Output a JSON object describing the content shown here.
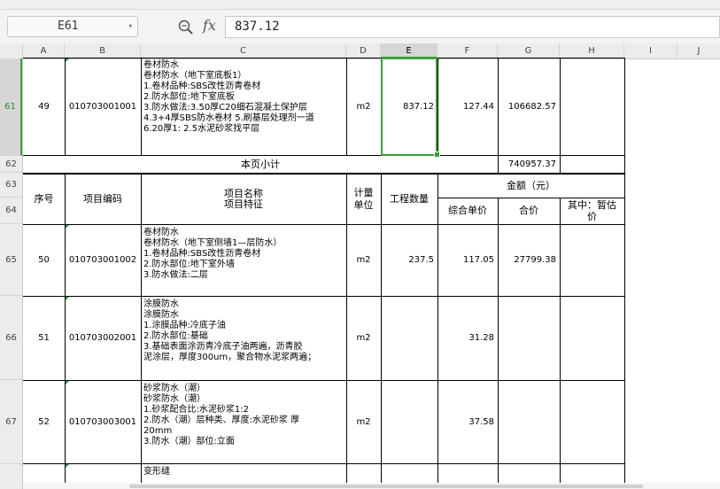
{
  "name_box": "E61",
  "formula_value": "837.12",
  "column_headers": [
    "A",
    "B",
    "C",
    "D",
    "E",
    "F",
    "G",
    "H",
    "I",
    "J"
  ],
  "row_headers": [
    "61",
    "62",
    "63",
    "64",
    "65",
    "66",
    "67"
  ],
  "rows": {
    "r61": {
      "seq": "49",
      "code": "010703001001",
      "desc": "卷材防水\n卷材防水（地下室底板1）\n1.卷材品种:SBS改性沥青卷材\n2.防水部位:地下室底板\n3.防水做法:3.50厚C20细石混凝土保护层\n4.3+4厚SBS防水卷材 5.刷基层处理剂一道\n6.20厚1: 2.5水泥砂浆找平层",
      "unit": "m2",
      "qty": "837.12",
      "price": "127.44",
      "total": "106682.57"
    },
    "r62": {
      "label": "本页小计",
      "total": "740957.37"
    },
    "header": {
      "seq": "序号",
      "code": "项目编码",
      "name": "项目名称\n项目特征",
      "unit": "计量\n单位",
      "qty": "工程数量",
      "amount": "金额（元）",
      "price": "综合单价",
      "total": "合价",
      "temp": "其中：暂估\n价"
    },
    "r65": {
      "seq": "50",
      "code": "010703001002",
      "desc": "卷材防水\n卷材防水（地下室侧墙1—层防水）\n1.卷材品种:SBS改性沥青卷材\n2.防水部位:地下室外墙\n3.防水做法:二层",
      "unit": "m2",
      "qty": "237.5",
      "price": "117.05",
      "total": "27799.38"
    },
    "r66": {
      "seq": "51",
      "code": "010703002001",
      "desc": "涂膜防水\n涂膜防水\n1.涂膜品种:冷底子油\n2.防水部位:基础\n3.基础表面涂沥青冷底子油两遍，沥青胶\n泥涂层，厚度300um，聚合物水泥浆两遍；",
      "unit": "m2",
      "qty": "",
      "price": "31.28",
      "total": ""
    },
    "r67": {
      "seq": "52",
      "code": "010703003001",
      "desc": "砂浆防水（潮）\n砂浆防水（潮）\n1.砂浆配合比:水泥砂浆1:2\n2.防水（潮）层种类、厚度:水泥砂浆 厚\n20mm\n3.防水（潮）部位:立面",
      "unit": "m2",
      "qty": "",
      "price": "37.58",
      "total": ""
    },
    "r68": {
      "desc": "变形缝"
    }
  }
}
